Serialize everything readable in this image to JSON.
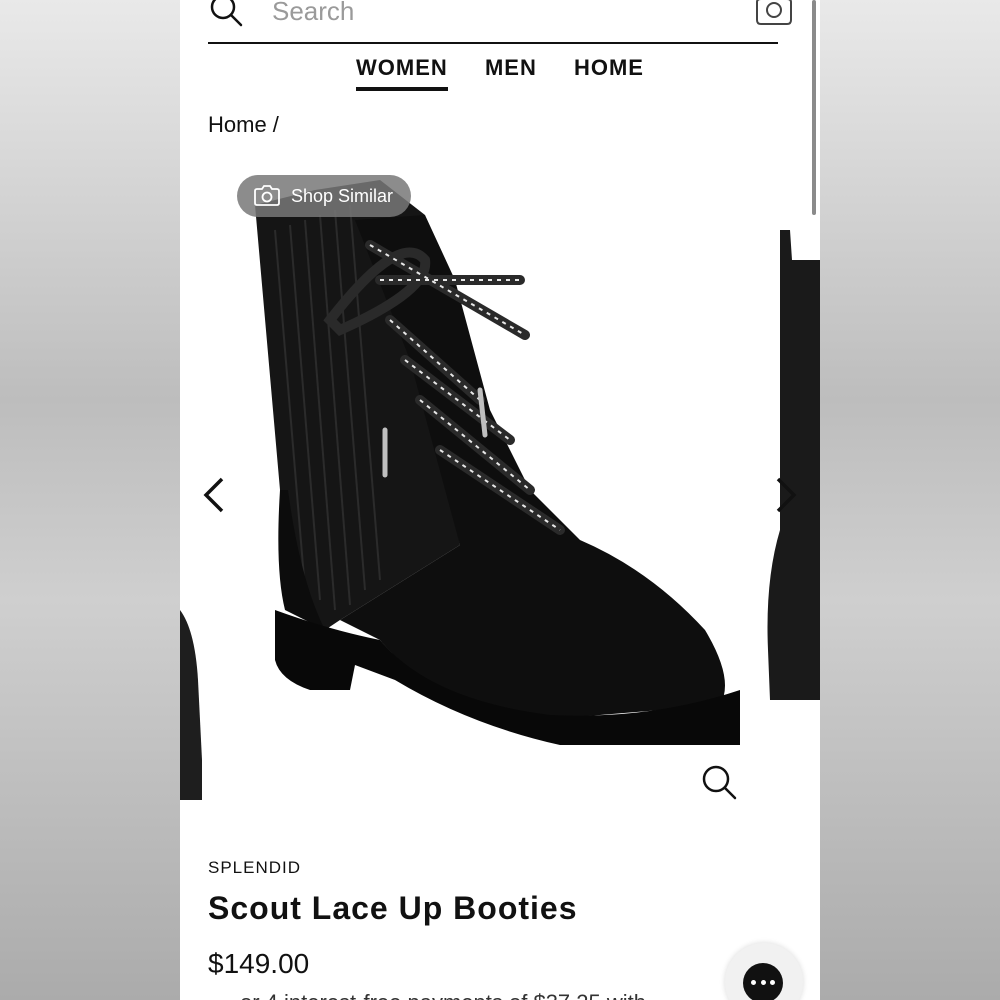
{
  "search": {
    "placeholder": "Search"
  },
  "nav": {
    "tabs": [
      {
        "label": "WOMEN"
      },
      {
        "label": "MEN"
      },
      {
        "label": "HOME"
      }
    ]
  },
  "breadcrumb": "Home /",
  "image": {
    "shop_similar_label": "Shop Similar"
  },
  "product": {
    "brand": "SPLENDID",
    "title": "Scout Lace Up Booties",
    "price": "$149.00",
    "installments": "or 4 interest-free payments of $37.25 with"
  },
  "icons": [
    "search-icon",
    "camera-icon",
    "chevron-left-icon",
    "chevron-right-icon",
    "zoom-icon",
    "chat-icon"
  ],
  "colors": {
    "text": "#111111",
    "pill_bg": "#787878"
  }
}
